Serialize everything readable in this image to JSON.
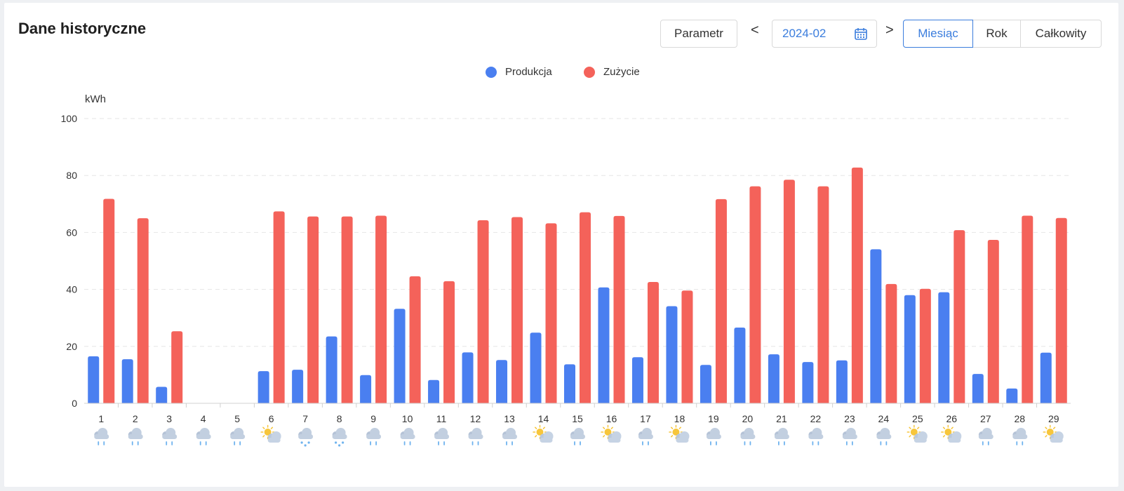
{
  "header": {
    "title": "Dane historyczne",
    "param_label": "Parametr",
    "prev_label": "<",
    "next_label": ">",
    "date_value": "2024-02",
    "period_options": [
      "Miesiąc",
      "Rok",
      "Całkowity"
    ],
    "active_period": "Miesiąc"
  },
  "colors": {
    "production": "#4a7ff0",
    "consumption": "#f4625a",
    "accent": "#3b7ddd"
  },
  "chart_data": {
    "type": "bar",
    "unit_label": "kWh",
    "ylim": [
      0,
      100
    ],
    "yticks": [
      0,
      20,
      40,
      60,
      80,
      100
    ],
    "grid": true,
    "legend_position": "top-center",
    "categories": [
      "1",
      "2",
      "3",
      "4",
      "5",
      "6",
      "7",
      "8",
      "9",
      "10",
      "11",
      "12",
      "13",
      "14",
      "15",
      "16",
      "17",
      "18",
      "19",
      "20",
      "21",
      "22",
      "23",
      "24",
      "25",
      "26",
      "27",
      "28",
      "29"
    ],
    "series": [
      {
        "name": "Produkcja",
        "values": [
          16.5,
          15.5,
          5.8,
          0,
          0,
          11.3,
          11.8,
          23.5,
          9.9,
          33.2,
          8.2,
          17.9,
          15.2,
          24.8,
          13.7,
          40.7,
          16.2,
          34.1,
          13.5,
          26.6,
          17.2,
          14.5,
          15.1,
          54.1,
          38.0,
          39.0,
          10.3,
          5.2,
          17.8
        ]
      },
      {
        "name": "Zużycie",
        "values": [
          71.8,
          65.0,
          25.3,
          0,
          0,
          67.4,
          65.6,
          65.6,
          65.9,
          44.6,
          42.9,
          64.3,
          65.4,
          63.2,
          67.1,
          65.8,
          42.6,
          39.6,
          71.7,
          76.2,
          78.5,
          76.2,
          82.8,
          41.9,
          40.2,
          60.8,
          57.4,
          65.9,
          65.1
        ]
      }
    ],
    "weather_icons": [
      "rain-icon",
      "rain-icon",
      "rain-icon",
      "rain-icon",
      "rain-icon",
      "partly-cloudy-icon",
      "snow-icon",
      "snow-icon",
      "rain-icon",
      "rain-icon",
      "rain-icon",
      "rain-icon",
      "rain-icon",
      "partly-cloudy-icon",
      "rain-icon",
      "partly-cloudy-icon",
      "rain-icon",
      "partly-cloudy-icon",
      "rain-icon",
      "rain-icon",
      "rain-icon",
      "rain-icon",
      "rain-icon",
      "rain-icon",
      "partly-cloudy-icon",
      "partly-cloudy-icon",
      "rain-icon",
      "rain-icon",
      "partly-cloudy-icon"
    ]
  }
}
